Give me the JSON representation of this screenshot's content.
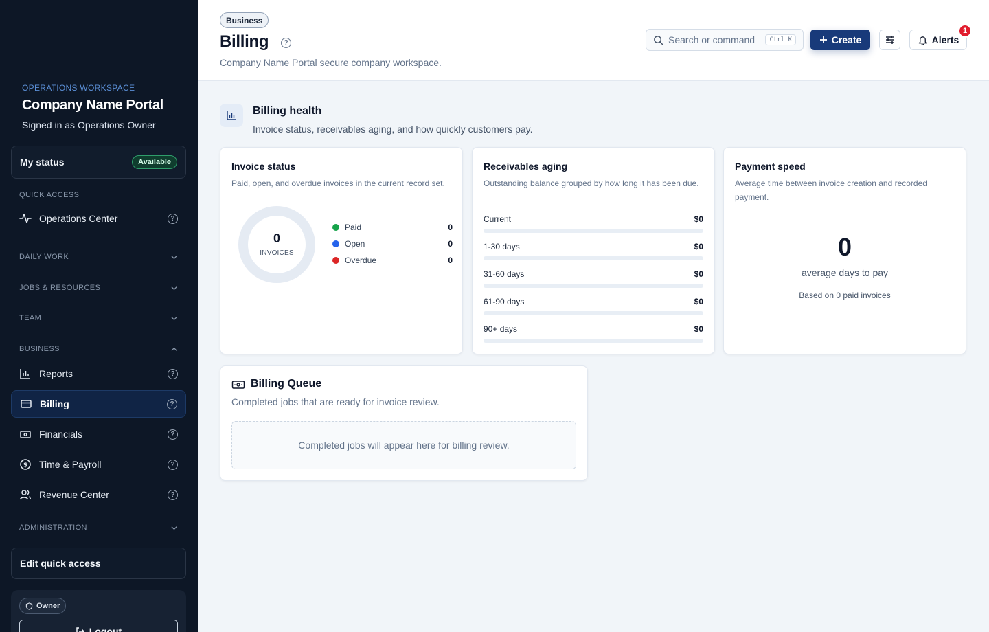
{
  "sidebar": {
    "workspace_eyebrow": "OPERATIONS WORKSPACE",
    "workspace_title": "Company Name Portal",
    "signed_in": "Signed in as Operations Owner",
    "status": {
      "label": "My status",
      "badge": "Available"
    },
    "sections": {
      "quick_access": "QUICK ACCESS",
      "daily_work": "DAILY WORK",
      "jobs_resources": "JOBS & RESOURCES",
      "team": "TEAM",
      "business": "BUSINESS",
      "administration": "ADMINISTRATION"
    },
    "items": [
      {
        "label": "Operations Center",
        "icon": "activity-icon"
      },
      {
        "label": "Reports",
        "icon": "bar-chart-icon"
      },
      {
        "label": "Billing",
        "icon": "credit-card-icon",
        "active": true
      },
      {
        "label": "Financials",
        "icon": "banknote-icon"
      },
      {
        "label": "Time & Payroll",
        "icon": "dollar-circle-icon"
      },
      {
        "label": "Revenue Center",
        "icon": "users-icon"
      }
    ],
    "edit_quick_access": "Edit quick access",
    "role_badge": "Owner",
    "logout": "Logout"
  },
  "header": {
    "breadcrumb": "Business",
    "title": "Billing",
    "subtitle": "Company Name Portal secure company workspace.",
    "search_placeholder": "Search or command",
    "search_shortcut": "Ctrl K",
    "create_label": "Create",
    "alerts_label": "Alerts",
    "alerts_count": "1"
  },
  "health": {
    "title": "Billing health",
    "subtitle": "Invoice status, receivables aging, and how quickly customers pay."
  },
  "invoice_status": {
    "title": "Invoice status",
    "subtitle": "Paid, open, and overdue invoices in the current record set.",
    "total": "0",
    "total_label": "INVOICES",
    "legend": [
      {
        "label": "Paid",
        "value": "0",
        "color": "#16a34a"
      },
      {
        "label": "Open",
        "value": "0",
        "color": "#2563eb"
      },
      {
        "label": "Overdue",
        "value": "0",
        "color": "#dc2626"
      }
    ],
    "ring_color": "#e5ebf3"
  },
  "aging": {
    "title": "Receivables aging",
    "subtitle": "Outstanding balance grouped by how long it has been due.",
    "buckets": [
      {
        "label": "Current",
        "amount": "$0",
        "fraction": 0
      },
      {
        "label": "1-30 days",
        "amount": "$0",
        "fraction": 0
      },
      {
        "label": "31-60 days",
        "amount": "$0",
        "fraction": 0
      },
      {
        "label": "61-90 days",
        "amount": "$0",
        "fraction": 0
      },
      {
        "label": "90+ days",
        "amount": "$0",
        "fraction": 0
      }
    ]
  },
  "payment_speed": {
    "title": "Payment speed",
    "subtitle": "Average time between invoice creation and recorded payment.",
    "value": "0",
    "label": "average days to pay",
    "basis": "Based on 0 paid invoices"
  },
  "queue": {
    "title": "Billing Queue",
    "subtitle": "Completed jobs that are ready for invoice review.",
    "empty": "Completed jobs will appear here for billing review."
  },
  "colors": {
    "accent": "#183a7a",
    "sidebar_bg": "#0d1726",
    "available": "#2f9e6b",
    "alert": "#e11d2e"
  }
}
